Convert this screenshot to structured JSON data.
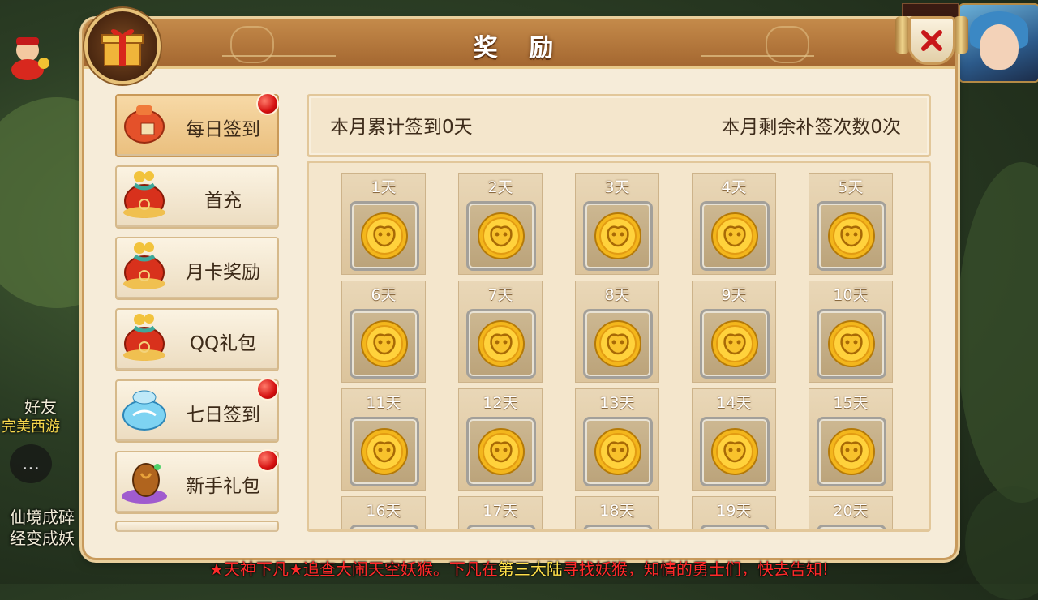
{
  "title": "奖 励",
  "sidebar": {
    "items": [
      {
        "label": "每日签到",
        "icon": "red-pouch-icon",
        "active": true,
        "red_dot": true
      },
      {
        "label": "首充",
        "icon": "coin-bag-icon",
        "active": false,
        "red_dot": false
      },
      {
        "label": "月卡奖励",
        "icon": "coin-bag-icon",
        "active": false,
        "red_dot": false
      },
      {
        "label": "QQ礼包",
        "icon": "coin-bag-icon",
        "active": false,
        "red_dot": false
      },
      {
        "label": "七日签到",
        "icon": "blue-pouch-icon",
        "active": false,
        "red_dot": true
      },
      {
        "label": "新手礼包",
        "icon": "purple-bag-icon",
        "active": false,
        "red_dot": true
      }
    ]
  },
  "info": {
    "left": "本月累计签到0天",
    "right": "本月剩余补签次数0次"
  },
  "days": [
    "1天",
    "2天",
    "3天",
    "4天",
    "5天",
    "6天",
    "7天",
    "8天",
    "9天",
    "10天",
    "11天",
    "12天",
    "13天",
    "14天",
    "15天",
    "16天",
    "17天",
    "18天",
    "19天",
    "20天"
  ],
  "background": {
    "left_lines": [
      "好友",
      "完美西游",
      "仙境成碎",
      "经变成妖"
    ]
  },
  "ticker": {
    "part1": "★天神下凡★追查大闹天空妖猴。下凡在",
    "part2": "第三大陆",
    "part3": "寻找妖猴，知情的勇士们，快去告知!"
  },
  "colors": {
    "accent_red": "#d40f0f",
    "panel_bg": "#f6ecd9",
    "header_brown": "#a46730",
    "ticker_red": "#ff2a2a",
    "ticker_yellow": "#ffe14a"
  }
}
